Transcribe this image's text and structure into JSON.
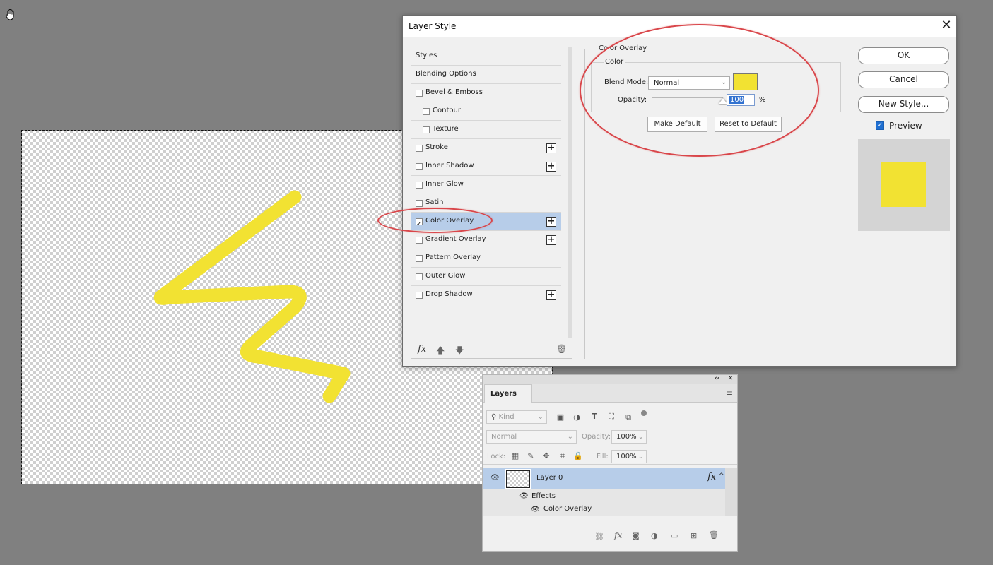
{
  "dialog": {
    "title": "Layer Style",
    "close": "✕",
    "styles": [
      {
        "label": "Styles",
        "checkbox": false,
        "plus": false
      },
      {
        "label": "Blending Options",
        "checkbox": false,
        "plus": false
      },
      {
        "label": "Bevel & Emboss",
        "checkbox": true,
        "checked": false,
        "plus": false
      },
      {
        "label": "Contour",
        "checkbox": true,
        "checked": false,
        "plus": false,
        "indent": true
      },
      {
        "label": "Texture",
        "checkbox": true,
        "checked": false,
        "plus": false,
        "indent": true
      },
      {
        "label": "Stroke",
        "checkbox": true,
        "checked": false,
        "plus": true
      },
      {
        "label": "Inner Shadow",
        "checkbox": true,
        "checked": false,
        "plus": true
      },
      {
        "label": "Inner Glow",
        "checkbox": true,
        "checked": false,
        "plus": false
      },
      {
        "label": "Satin",
        "checkbox": true,
        "checked": false,
        "plus": false
      },
      {
        "label": "Color Overlay",
        "checkbox": true,
        "checked": true,
        "plus": true,
        "selected": true
      },
      {
        "label": "Gradient Overlay",
        "checkbox": true,
        "checked": false,
        "plus": true
      },
      {
        "label": "Pattern Overlay",
        "checkbox": true,
        "checked": false,
        "plus": false
      },
      {
        "label": "Outer Glow",
        "checkbox": true,
        "checked": false,
        "plus": false
      },
      {
        "label": "Drop Shadow",
        "checkbox": true,
        "checked": false,
        "plus": true
      }
    ],
    "footer_icons": {
      "fx": "fx",
      "up": "🡅",
      "down": "🡇",
      "trash": "🗑"
    },
    "overlay": {
      "section_title": "Color Overlay",
      "group_title": "Color",
      "blend_mode_label": "Blend Mode:",
      "blend_mode_value": "Normal",
      "opacity_label": "Opacity:",
      "opacity_value": "100",
      "opacity_unit": "%",
      "opacity_fraction": 1.0,
      "color": "#f2e232",
      "make_default": "Make Default",
      "reset_default": "Reset to Default"
    },
    "buttons": {
      "ok": "OK",
      "cancel": "Cancel",
      "new_style": "New Style..."
    },
    "preview_label": "Preview",
    "preview_checked": true
  },
  "layers_panel": {
    "tab": "Layers",
    "collapse": "‹‹",
    "close": "✕",
    "menu": "≡",
    "kind_placeholder": "Kind",
    "blend_mode": "Normal",
    "opacity_label": "Opacity:",
    "opacity_value": "100%",
    "lock_label": "Lock:",
    "fill_label": "Fill:",
    "fill_value": "100%",
    "layer_name": "Layer 0",
    "fx_badge": "fx",
    "effects_label": "Effects",
    "effect_item": "Color Overlay"
  },
  "colors": {
    "accent_selection": "#b7cde9",
    "stroke_yellow": "#f2e232",
    "annotation_red": "#d9464a"
  }
}
